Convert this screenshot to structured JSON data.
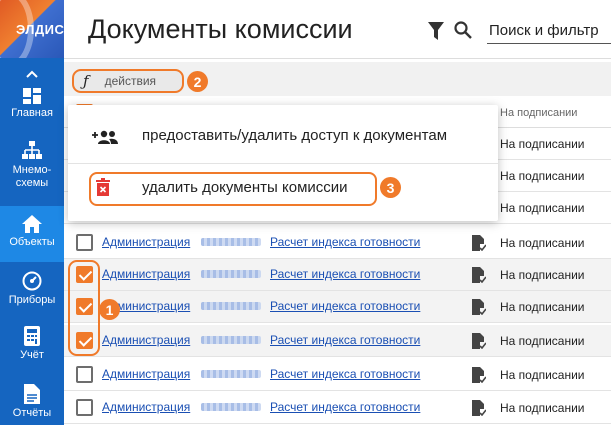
{
  "app": {
    "logo_text": "ЭЛДИС"
  },
  "sidebar": {
    "items": [
      {
        "label": "Главная",
        "icon": "dashboard-icon"
      },
      {
        "label": "Мнемо-\nсхемы",
        "icon": "hierarchy-icon"
      },
      {
        "label": "Объекты",
        "icon": "home-icon",
        "active": true
      },
      {
        "label": "Приборы",
        "icon": "gauge-icon"
      },
      {
        "label": "Учёт",
        "icon": "calculator-icon"
      },
      {
        "label": "Отчёты",
        "icon": "report-icon"
      }
    ]
  },
  "header": {
    "title": "Документы комиссии",
    "search_placeholder": "Поиск и фильтр"
  },
  "toolbar": {
    "actions_label": "действия",
    "actions_icon": "function-icon"
  },
  "table": {
    "status_header": "На подписании",
    "rows": [
      {
        "col1": "",
        "col2": "",
        "status": "На подписании",
        "checked": false
      },
      {
        "col1": "",
        "col2": "",
        "status": "На подписании",
        "checked": false
      },
      {
        "col1": "",
        "col2": "",
        "status": "На подписании",
        "checked": false
      },
      {
        "col1": "Администрация",
        "col2": "Расчет индекса готовности",
        "status": "На подписании",
        "checked": false
      },
      {
        "col1": "Администрация",
        "col2": "Расчет индекса готовности",
        "status": "На подписании",
        "checked": true
      },
      {
        "col1": "Администрация",
        "col2": "Расчет индекса готовности",
        "status": "На подписании",
        "checked": true
      },
      {
        "col1": "Администрация",
        "col2": "Расчет индекса готовности",
        "status": "На подписании",
        "checked": true
      },
      {
        "col1": "Администрация",
        "col2": "Расчет индекса готовности",
        "status": "На подписании",
        "checked": false
      },
      {
        "col1": "Администрация",
        "col2": "Расчет индекса готовности",
        "status": "На подписании",
        "checked": false
      }
    ]
  },
  "menu": {
    "items": [
      {
        "label": "предоставить/удалить доступ к документам",
        "icon": "add-people-icon"
      },
      {
        "label": "удалить документы комиссии",
        "icon": "delete-icon"
      }
    ]
  },
  "callouts": [
    "1",
    "2",
    "3"
  ],
  "colors": {
    "sidebar": "#1565c0",
    "accent": "#f07a2a",
    "link": "#1a4fb3",
    "delete": "#e53935"
  }
}
